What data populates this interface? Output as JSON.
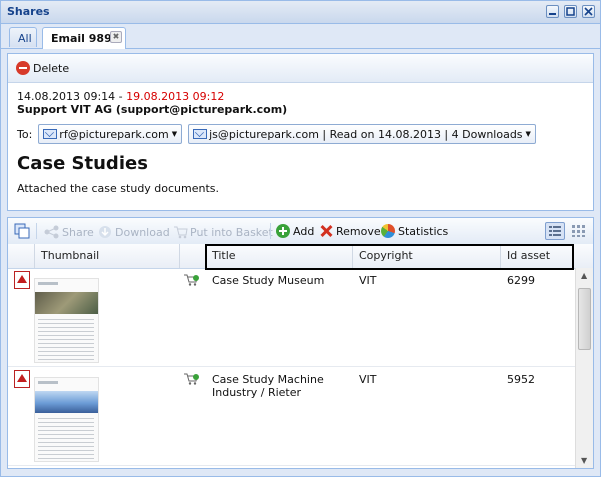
{
  "window": {
    "title": "Shares"
  },
  "tabs": [
    {
      "label": "All"
    },
    {
      "label": "Email 989",
      "close": "✖"
    }
  ],
  "detail": {
    "delete_label": "Delete",
    "date_start": "14.08.2013 09:14",
    "date_sep": " - ",
    "date_end": "19.08.2013 09:12",
    "sender": "Support VIT AG (support@picturepark.com)",
    "to_label": "To:",
    "recipients": [
      {
        "label": "rf@picturepark.com"
      },
      {
        "label": "js@picturepark.com | Read on 14.08.2013 | 4 Downloads"
      }
    ],
    "subject": "Case Studies",
    "body": "Attached the case study documents."
  },
  "grid_toolbar": {
    "share": "Share",
    "download": "Download",
    "put_into_basket": "Put into Basket",
    "add": "Add",
    "remove": "Remove",
    "statistics": "Statistics"
  },
  "columns": {
    "thumbnail": "Thumbnail",
    "title": "Title",
    "copyright": "Copyright",
    "id": "Id asset"
  },
  "rows": [
    {
      "title_line1": "Case Study Museum",
      "title_line2": "",
      "copyright": "VIT",
      "id": "6299"
    },
    {
      "title_line1": "Case Study Machine",
      "title_line2": "Industry / Rieter",
      "copyright": "VIT",
      "id": "5952"
    }
  ],
  "colors": {
    "accent": "#15428b",
    "date_end": "#d60000",
    "border": "#99bbe8"
  }
}
